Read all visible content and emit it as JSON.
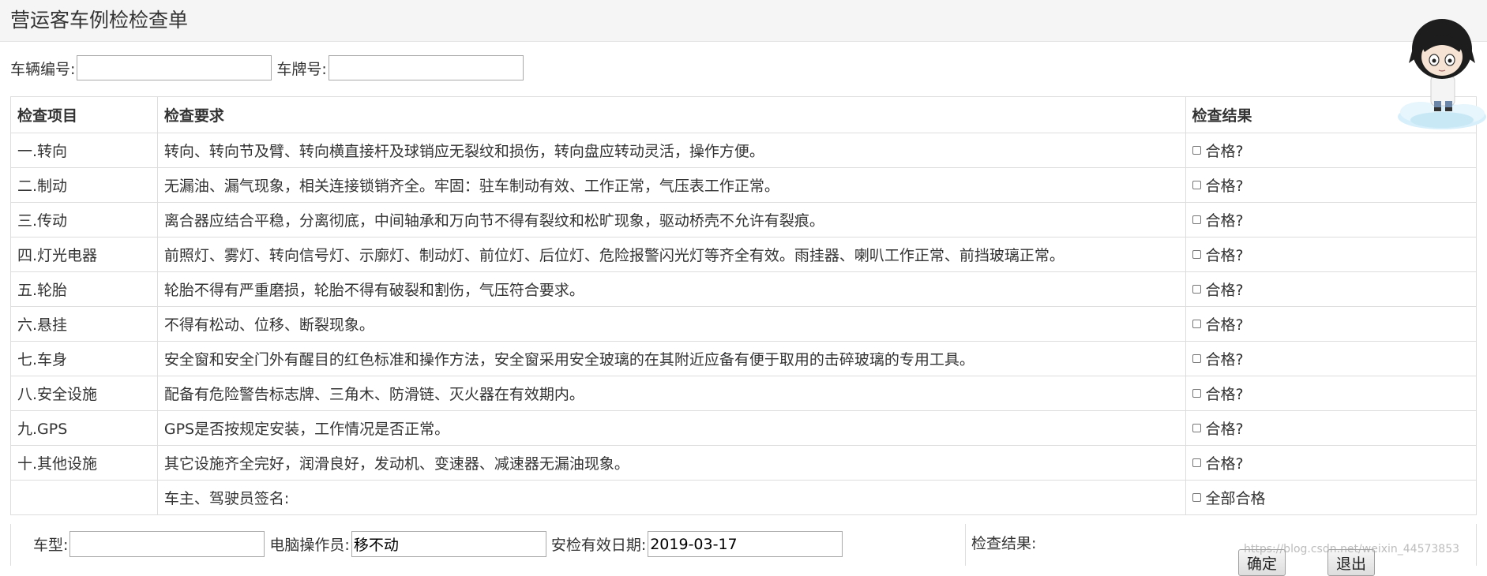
{
  "page": {
    "title": "营运客车例检检查单"
  },
  "filters": {
    "vehicle_no_label": "车辆编号:",
    "vehicle_no_value": "",
    "plate_label": "车牌号:",
    "plate_value": ""
  },
  "table": {
    "headers": [
      "检查项目",
      "检查要求",
      "检查结果"
    ],
    "rows": [
      {
        "item": "一.转向",
        "requirement": "转向、转向节及臂、转向横直接杆及球销应无裂纹和损伤，转向盘应转动灵活，操作方便。",
        "result": "合格?"
      },
      {
        "item": "二.制动",
        "requirement": "无漏油、漏气现象，相关连接锁销齐全。牢固：驻车制动有效、工作正常，气压表工作正常。",
        "result": "合格?"
      },
      {
        "item": "三.传动",
        "requirement": "离合器应结合平稳，分离彻底，中间轴承和万向节不得有裂纹和松旷现象，驱动桥壳不允许有裂痕。",
        "result": "合格?"
      },
      {
        "item": "四.灯光电器",
        "requirement": "前照灯、雾灯、转向信号灯、示廓灯、制动灯、前位灯、后位灯、危险报警闪光灯等齐全有效。雨挂器、喇叭工作正常、前挡玻璃正常。",
        "result": "合格?"
      },
      {
        "item": "五.轮胎",
        "requirement": "轮胎不得有严重磨损，轮胎不得有破裂和割伤，气压符合要求。",
        "result": "合格?"
      },
      {
        "item": "六.悬挂",
        "requirement": "不得有松动、位移、断裂现象。",
        "result": "合格?"
      },
      {
        "item": "七.车身",
        "requirement": "安全窗和安全门外有醒目的红色标准和操作方法，安全窗采用安全玻璃的在其附近应备有便于取用的击碎玻璃的专用工具。",
        "result": "合格?"
      },
      {
        "item": "八.安全设施",
        "requirement": "配备有危险警告标志牌、三角木、防滑链、灭火器在有效期内。",
        "result": "合格?"
      },
      {
        "item": "九.GPS",
        "requirement": "GPS是否按规定安装，工作情况是否正常。",
        "result": "合格?"
      },
      {
        "item": "十.其他设施",
        "requirement": "其它设施齐全完好，润滑良好，发动机、变速器、减速器无漏油现象。",
        "result": "合格?"
      }
    ],
    "signature_label": "车主、驾驶员签名:",
    "all_pass_label": "全部合格"
  },
  "footer": {
    "model_label": "车型:",
    "model_value": "",
    "operator_label": "电脑操作员:",
    "operator_value": "移不动",
    "valid_date_label": "安检有效日期:",
    "valid_date_value": "2019-03-17",
    "result_label": "检查结果:",
    "ok_label": "确定",
    "exit_label": "退出"
  },
  "watermark": "https://blog.csdn.net/weixin_44573853"
}
